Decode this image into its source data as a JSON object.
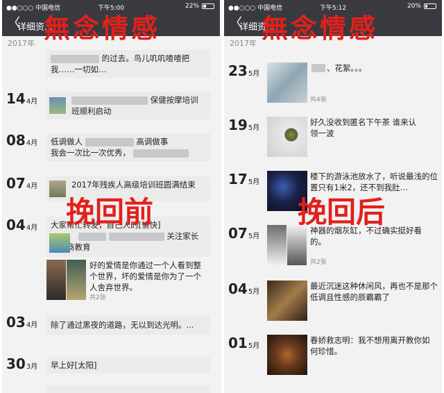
{
  "left": {
    "status": {
      "carrier": "●●○○○ 中国电信",
      "time": "下午5:00",
      "battery": "22%"
    },
    "nav": {
      "back": "〈",
      "title": "详细资..."
    },
    "watermark": "無念情感",
    "year": "2017年",
    "overlay": "挽回前",
    "posts": [
      {
        "day": "",
        "mon": "",
        "text": "的过去。鸟儿叽叽喳喳把我……一切如…",
        "label": "top"
      },
      {
        "day": "14",
        "mon": "4月",
        "text": "保健按摩培训班顺利启动"
      },
      {
        "day": "08",
        "mon": "4月",
        "text1": "低调做人",
        "text2": "高调做事",
        "text3": "我会一次比一次优秀，"
      },
      {
        "day": "07",
        "mon": "4月",
        "text": "2017年残疾人高级培训班圆满结束"
      },
      {
        "day": "04",
        "mon": "4月",
        "text": "大家帮忙转发，自己人的[愉快]",
        "text_b": "关注家长的情商教育",
        "text_c": "好的爱情是你通过一个人看到整个世界，坏的爱情是你为了一个人舍弃世界。",
        "count": "共2张"
      },
      {
        "day": "03",
        "mon": "4月",
        "text": "除了通过黑夜的道路，无以到达光明。..."
      },
      {
        "day": "30",
        "mon": "3月",
        "text": "早上好[太阳]"
      }
    ]
  },
  "right": {
    "status": {
      "carrier": "●●○○○ 中国电信",
      "time": "下午5:12",
      "battery": "20%"
    },
    "nav": {
      "back": "〈",
      "title": "详细资..."
    },
    "watermark": "無念情感",
    "year": "2017年",
    "overlay": "挽回后",
    "posts": [
      {
        "day": "23",
        "mon": "5月",
        "text": "、花絮。。。",
        "count": "共4张"
      },
      {
        "day": "19",
        "mon": "5月",
        "text": "好久没收到匿名下午茶 谁来认领一波"
      },
      {
        "day": "17",
        "mon": "5月",
        "text": "楼下的游泳池放水了，听说最浅的位置只有1米2，还不到我肚…"
      },
      {
        "day": "07",
        "mon": "5月",
        "text": "神器的烟灰缸，不过确实挺好看的。",
        "count": "共2张"
      },
      {
        "day": "04",
        "mon": "5月",
        "text": "最近沉迷这种休闲风，再也不是那个低调且性感的辰霸霸了"
      },
      {
        "day": "01",
        "mon": "5月",
        "text": "春娇救志明：我不想用离开教你如何珍惜。"
      }
    ]
  },
  "colors": {
    "accent": "#e2201c",
    "navbar": "#393a3f",
    "status": "#3a3a3f"
  }
}
